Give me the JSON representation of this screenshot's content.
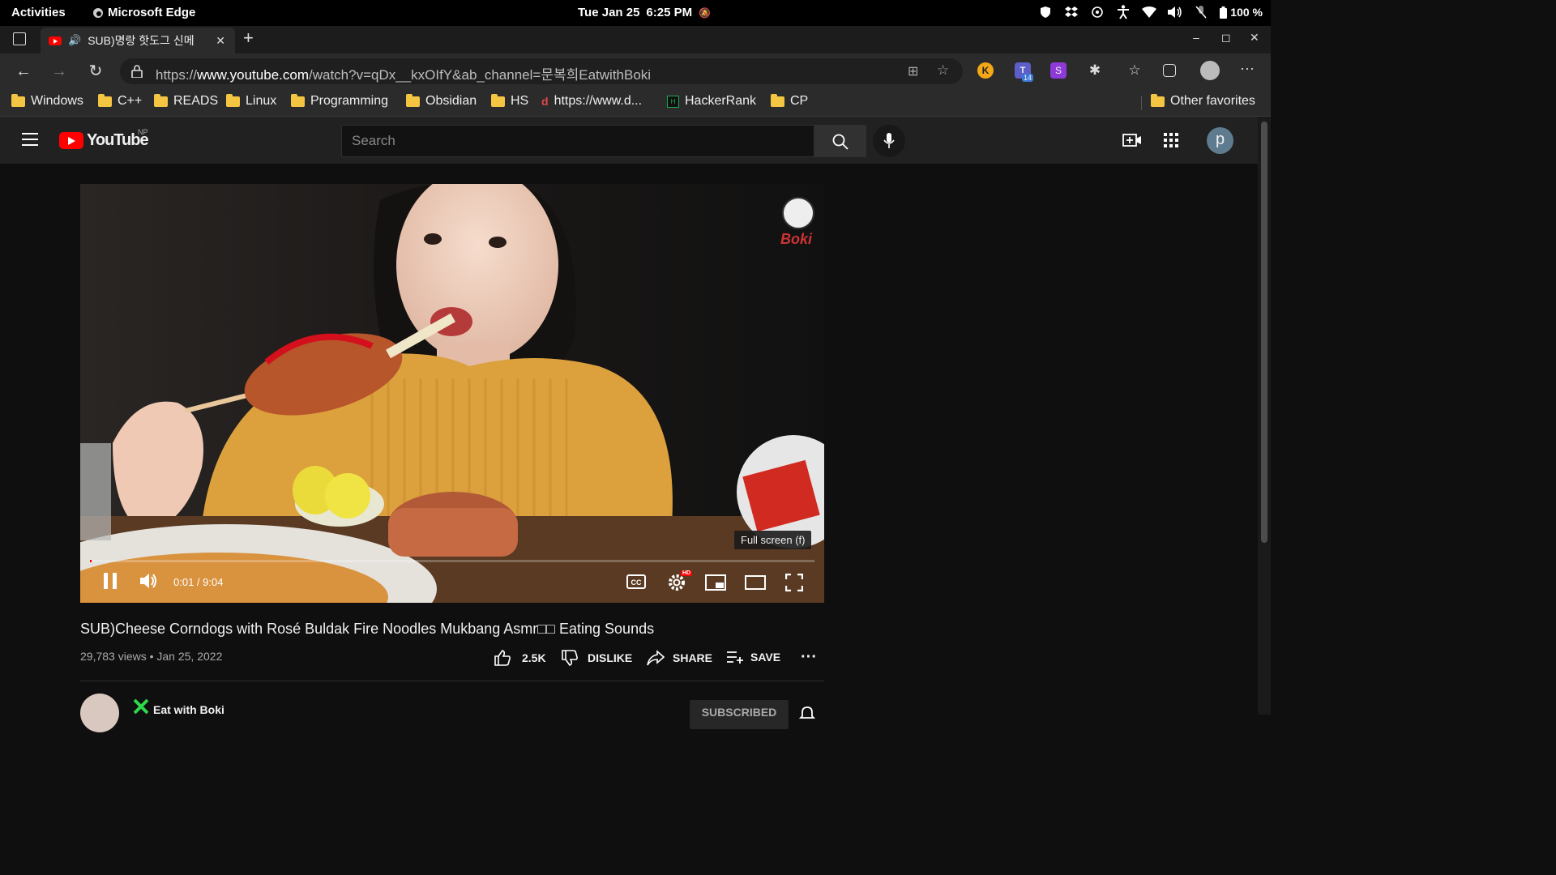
{
  "topbar": {
    "activities": "Activities",
    "app_name": "Microsoft Edge",
    "date": "Tue Jan 25",
    "time": "6:25 PM",
    "battery": "100 %"
  },
  "tab": {
    "title": "SUB)명랑 핫도그 신메"
  },
  "address": {
    "prefix": "https://",
    "host": "www.youtube.com",
    "path": "/watch?v=qDx__kxOIfY&ab_channel=문복희EatwithBoki"
  },
  "extensions": {
    "teams_badge": "14",
    "s_label": "S"
  },
  "favorites": [
    {
      "label": "Windows",
      "icon": "folder"
    },
    {
      "label": "C++",
      "icon": "folder"
    },
    {
      "label": "READS",
      "icon": "folder"
    },
    {
      "label": "Linux",
      "icon": "folder"
    },
    {
      "label": "Programming",
      "icon": "folder"
    },
    {
      "label": "Obsidian",
      "icon": "folder"
    },
    {
      "label": "HS",
      "icon": "folder"
    },
    {
      "label": "https://www.d...",
      "icon": "site"
    },
    {
      "label": "HackerRank",
      "icon": "hackerrank"
    },
    {
      "label": "CP",
      "icon": "folder"
    }
  ],
  "other_favorites": "Other favorites",
  "youtube": {
    "logo": "YouTube",
    "region": "NP",
    "search_placeholder": "Search",
    "avatar_letter": "p"
  },
  "player": {
    "time": "0:01 / 9:04",
    "progress_fraction": 0.002,
    "tooltip": "Full screen (f)",
    "watermark": "Boki",
    "hd_badge": "HD"
  },
  "video": {
    "title": "SUB)Cheese Corndogs with Rosé Buldak Fire Noodles Mukbang Asmr□□ Eating Sounds",
    "stats": "29,783 views • Jan 25, 2022",
    "likes": "2.5K",
    "dislike": "DISLIKE",
    "share": "SHARE",
    "save": "SAVE",
    "channel": "Eat with Boki",
    "subscribe": "SUBSCRIBED"
  },
  "colors": {
    "accent": "#ff0000",
    "bg": "#0f0f0f",
    "header": "#212121"
  }
}
